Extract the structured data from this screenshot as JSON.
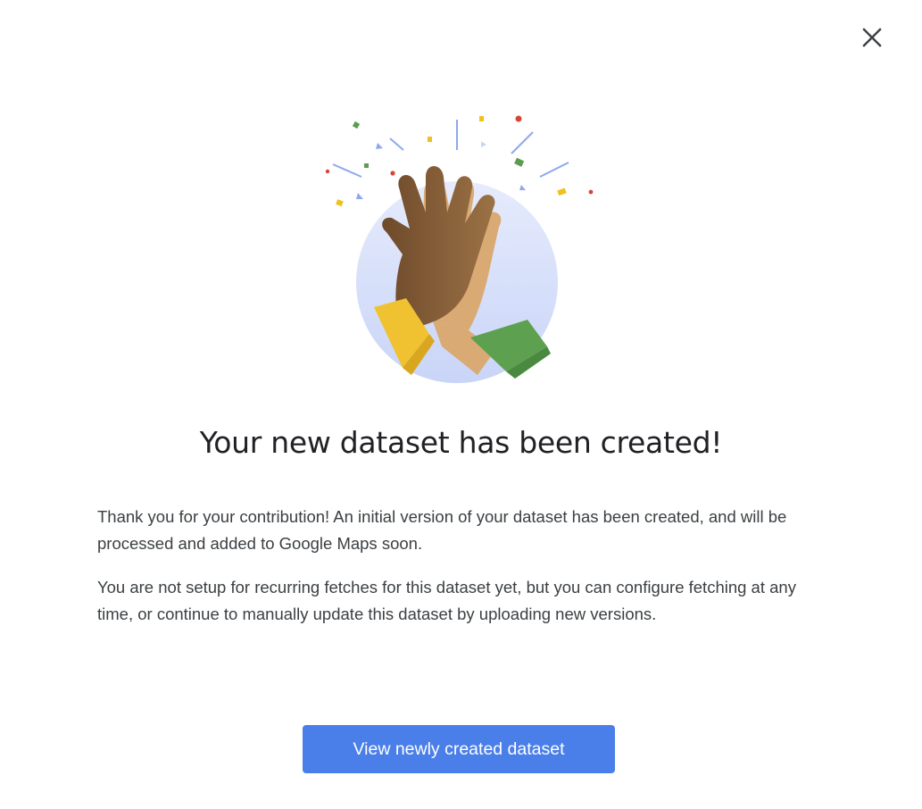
{
  "dialog": {
    "close_icon": "close-icon",
    "illustration": "high-five-illustration",
    "title": "Your new dataset has been created!",
    "paragraph_1": "Thank you for your contribution! An initial version of your dataset has been created, and will be processed and added to Google Maps soon.",
    "paragraph_2": "You are not setup for recurring fetches for this dataset yet, but you can configure fetching at any time, or continue to manually update this dataset by uploading new versions.",
    "primary_button_label": "View newly created dataset"
  },
  "colors": {
    "primary": "#4a7ee8",
    "title_text": "#202124",
    "body_text": "#3c4043",
    "illustration_circle": "#d7e0fb"
  }
}
